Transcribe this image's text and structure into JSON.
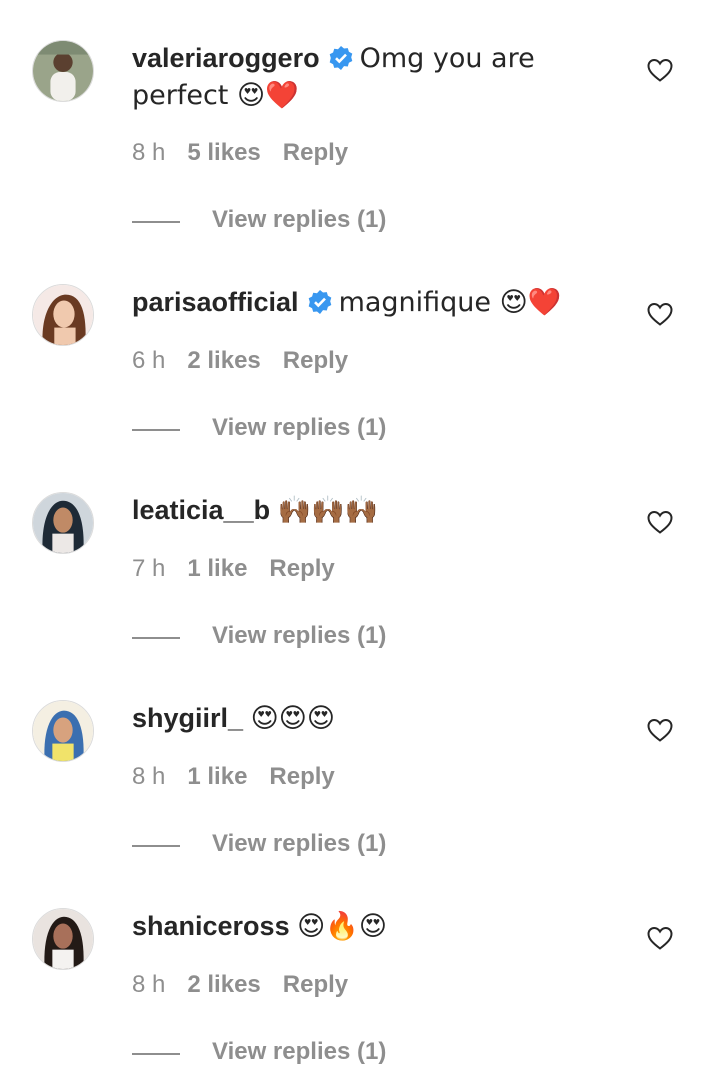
{
  "comments": [
    {
      "username": "valeriaroggero",
      "verified": true,
      "text": "Omg you are perfect 😍❤️",
      "time": "8 h",
      "likes": "5 likes",
      "reply": "Reply",
      "view_replies": "View replies (1)"
    },
    {
      "username": "parisaofficial",
      "verified": true,
      "text": "magnifique 😍❤️",
      "time": "6 h",
      "likes": "2 likes",
      "reply": "Reply",
      "view_replies": "View replies (1)"
    },
    {
      "username": "leaticia__b",
      "verified": false,
      "text": "🙌🏾🙌🏾🙌🏾",
      "time": "7 h",
      "likes": "1 like",
      "reply": "Reply",
      "view_replies": "View replies (1)"
    },
    {
      "username": "shygiirl_",
      "verified": false,
      "text": "😍😍😍",
      "time": "8 h",
      "likes": "1 like",
      "reply": "Reply",
      "view_replies": "View replies (1)"
    },
    {
      "username": "shaniceross",
      "verified": false,
      "text": "😍🔥😍",
      "time": "8 h",
      "likes": "2 likes",
      "reply": "Reply",
      "view_replies": "View replies (1)"
    }
  ],
  "icons": {
    "verified": "verified-badge-icon",
    "like": "heart-outline-icon"
  },
  "colors": {
    "verified": "#3897f0",
    "muted": "#8e8e8e",
    "text": "#262626"
  }
}
